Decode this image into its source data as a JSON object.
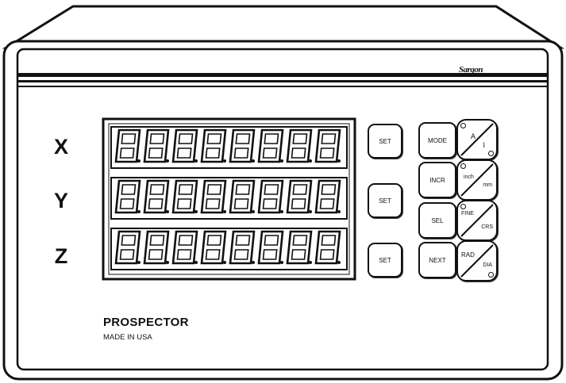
{
  "brand": {
    "logo_text": "Sargon",
    "model": "PROSPECTOR",
    "origin": "MADE IN USA"
  },
  "axes": [
    {
      "label": "X",
      "set_label": "SET"
    },
    {
      "label": "Y",
      "set_label": "SET"
    },
    {
      "label": "Z",
      "set_label": "SET"
    }
  ],
  "function_keys": {
    "mode": "MODE",
    "incr": "INCR",
    "sel": "SEL",
    "next": "NEXT"
  },
  "toggles": [
    {
      "top": "A",
      "bottom": "I"
    },
    {
      "top": "inch",
      "bottom": "mm"
    },
    {
      "top": "FINE",
      "bottom": "CRS"
    },
    {
      "top": "RAD",
      "bottom": "DIA"
    }
  ],
  "display": {
    "digits_per_row": 8,
    "segment_state": "all-on"
  },
  "colors": {
    "outline": "#111111",
    "display_bg": "#ffffff"
  }
}
